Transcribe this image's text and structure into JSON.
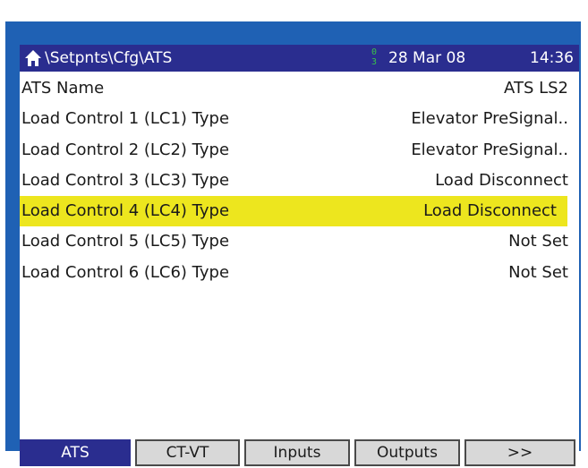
{
  "title_bar": {
    "path": "\\Setpnts\\Cfg\\ATS",
    "key_icon": "key-icon",
    "date": "28 Mar 08",
    "time": "14:36"
  },
  "rows": [
    {
      "label": "ATS Name",
      "value": "ATS LS2",
      "selected": false
    },
    {
      "label": "Load Control 1 (LC1) Type",
      "value": "Elevator PreSignal..",
      "selected": false
    },
    {
      "label": "Load Control 2 (LC2) Type",
      "value": "Elevator PreSignal..",
      "selected": false
    },
    {
      "label": "Load Control 3 (LC3) Type",
      "value": "Load Disconnect",
      "selected": false
    },
    {
      "label": "Load Control 4 (LC4) Type",
      "value": "Load Disconnect",
      "selected": true
    },
    {
      "label": "Load Control 5 (LC5) Type",
      "value": "Not Set",
      "selected": false
    },
    {
      "label": "Load Control 6 (LC6) Type",
      "value": "Not Set",
      "selected": false
    }
  ],
  "softkeys": [
    {
      "label": "ATS",
      "active": true
    },
    {
      "label": "CT-VT",
      "active": false
    },
    {
      "label": "Inputs",
      "active": false
    },
    {
      "label": "Outputs",
      "active": false
    },
    {
      "label": ">>",
      "active": false
    }
  ],
  "colors": {
    "bezel": "#1f61b4",
    "title_bar": "#2a2d8f",
    "selection": "#ede61e",
    "softkey_active": "#2a2d8f",
    "softkey": "#d8d8d8"
  }
}
